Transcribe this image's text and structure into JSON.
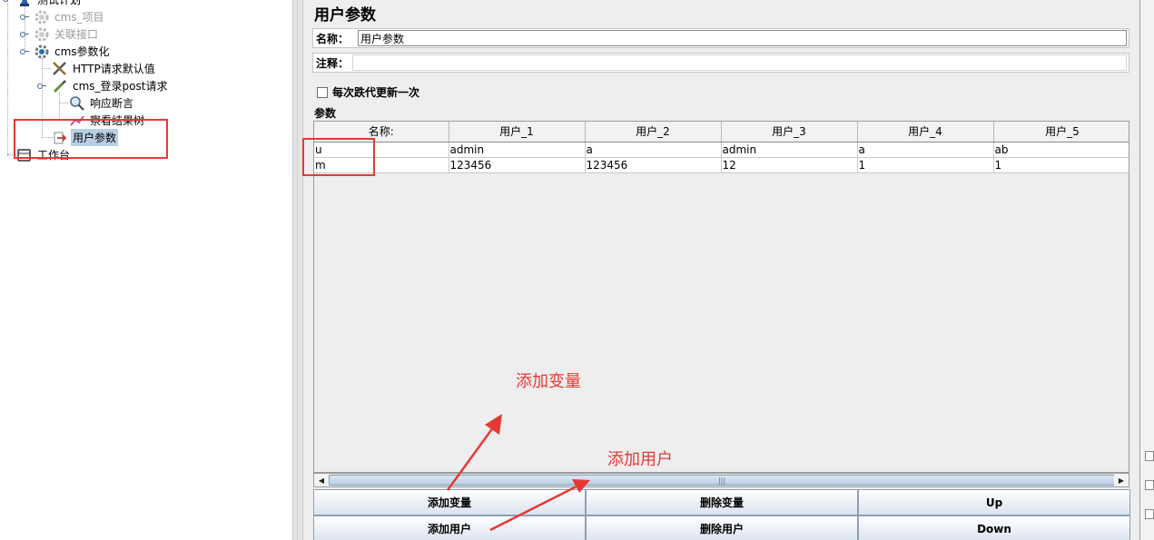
{
  "tree": {
    "items": [
      {
        "label": "测试计划",
        "icon": "test-plan-icon",
        "disabled": false
      },
      {
        "label": "cms_项目",
        "icon": "gear-icon",
        "disabled": true
      },
      {
        "label": "关联接口",
        "icon": "gear-icon",
        "disabled": true
      },
      {
        "label": "cms参数化",
        "icon": "gear-icon",
        "disabled": false
      },
      {
        "label": "HTTP请求默认值",
        "icon": "wrench-icon",
        "disabled": false
      },
      {
        "label": "cms_登录post请求",
        "icon": "pipette-icon",
        "disabled": false
      },
      {
        "label": "响应断言",
        "icon": "magnifier-icon",
        "disabled": false
      },
      {
        "label": "察看结果树",
        "icon": "chart-icon",
        "disabled": false
      },
      {
        "label": "用户参数",
        "icon": "preprocessor-icon",
        "disabled": false,
        "selected": true
      },
      {
        "label": "工作台",
        "icon": "workbench-icon",
        "disabled": false
      }
    ]
  },
  "panel": {
    "title": "用户参数",
    "name_label": "名称：",
    "name_value": "用户参数",
    "comment_label": "注释：",
    "comment_value": "",
    "iteration_checkbox_label": "每次跌代更新一次",
    "iteration_checked": false,
    "params_label": "参数"
  },
  "table": {
    "headers": [
      "名称:",
      "用户_1",
      "用户_2",
      "用户_3",
      "用户_4",
      "用户_5"
    ],
    "rows": [
      [
        "u",
        "admin",
        "a",
        "admin",
        "a",
        "ab"
      ],
      [
        "m",
        "123456",
        "123456",
        "12",
        "1",
        "1"
      ]
    ]
  },
  "buttons": {
    "add_variable": "添加变量",
    "delete_variable": "删除变量",
    "up": "Up",
    "add_user": "添加用户",
    "delete_user": "删除用户",
    "down": "Down"
  },
  "annotations": {
    "add_variable": "添加变量",
    "add_user": "添加用户",
    "color": "#e53935"
  },
  "colors": {
    "selection": "#b8cfe5",
    "annotation": "#e53935",
    "button_border": "#8aa0b8"
  }
}
